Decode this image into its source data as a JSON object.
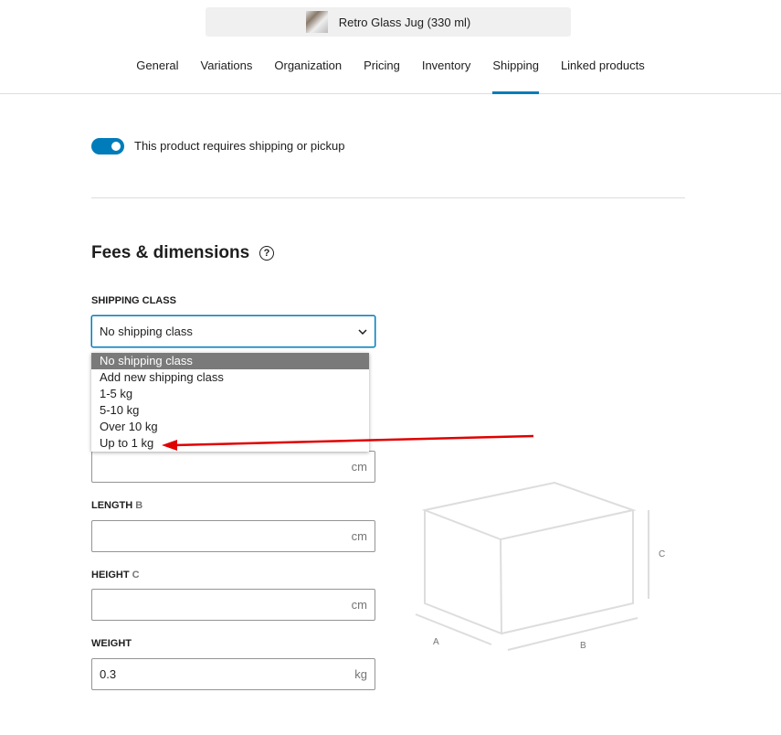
{
  "header": {
    "product_title": "Retro Glass Jug (330 ml)"
  },
  "tabs": [
    {
      "label": "General"
    },
    {
      "label": "Variations"
    },
    {
      "label": "Organization"
    },
    {
      "label": "Pricing"
    },
    {
      "label": "Inventory"
    },
    {
      "label": "Shipping",
      "active": true
    },
    {
      "label": "Linked products"
    }
  ],
  "shipping_toggle": {
    "label": "This product requires shipping or pickup",
    "on": true
  },
  "section": {
    "title": "Fees & dimensions",
    "help_icon": "?"
  },
  "shipping_class": {
    "label": "SHIPPING CLASS",
    "value": "No shipping class",
    "options": [
      "No shipping class",
      "Add new shipping class",
      "1-5 kg",
      "5-10 kg",
      "Over 10 kg",
      "Up to 1 kg"
    ]
  },
  "width": {
    "unit": "cm",
    "value": ""
  },
  "length": {
    "label": "LENGTH",
    "letter": "B",
    "unit": "cm",
    "value": ""
  },
  "height": {
    "label": "HEIGHT",
    "letter": "C",
    "unit": "cm",
    "value": ""
  },
  "weight": {
    "label": "WEIGHT",
    "unit": "kg",
    "value": "0.3"
  },
  "diagram": {
    "a": "A",
    "b": "B",
    "c": "C"
  },
  "colors": {
    "accent": "#007cba",
    "annotation_arrow": "#e00000"
  }
}
